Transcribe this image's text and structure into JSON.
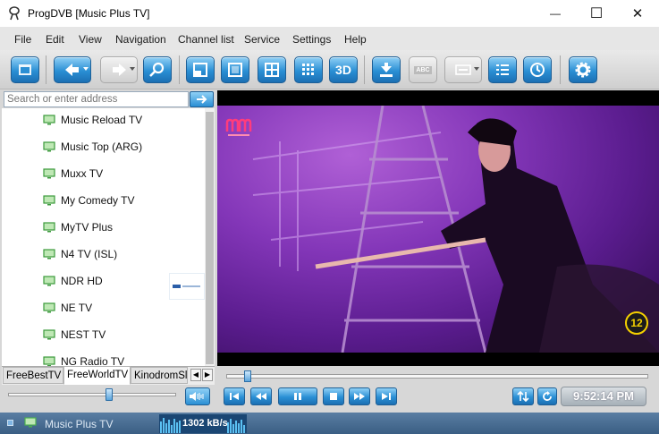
{
  "window": {
    "title": "ProgDVB [Music Plus TV]",
    "minimize_glyph": "—",
    "maximize_glyph": "☐",
    "close_glyph": "✕"
  },
  "menu": [
    "File",
    "Edit",
    "View",
    "Navigation",
    "Channel list",
    "Service",
    "Settings",
    "Help"
  ],
  "toolbar": {
    "buttons": [
      "folder-icon",
      "back-icon",
      "forward-icon",
      "search-icon",
      "window-icon",
      "fullscreen-icon",
      "grid-icon",
      "mosaic-icon",
      "3d-icon",
      "record-icon",
      "teletext-icon",
      "subtitles-icon",
      "channel-list-icon",
      "scheduler-icon",
      "settings-icon"
    ],
    "three_d_label": "3D",
    "teletext_label": "ABC"
  },
  "address": {
    "placeholder": "Search or enter address"
  },
  "channels": [
    "Music Reload TV",
    "Music Top (ARG)",
    "Muxx TV",
    "My Comedy TV",
    "MyTV Plus",
    "N4 TV (ISL)",
    "NDR HD",
    "NE TV",
    "NEST TV",
    "NG Radio TV"
  ],
  "tabs": {
    "items": [
      "FreeBestTV",
      "FreeWorldTV",
      "KinodromSly"
    ],
    "active": "FreeWorldTV",
    "scroll_left": "◀",
    "scroll_right": "▶"
  },
  "video": {
    "age_rating": "12"
  },
  "player": {
    "clock": "9:52:14 PM",
    "volume_level": 0.6,
    "seek_position": 0.05
  },
  "status": {
    "channel": "Music Plus TV",
    "bitrate": "1302 kB/s"
  },
  "colors": {
    "accent": "#2a8fd4",
    "status_bg": "#4a6e93",
    "channel_icon": "#4caf50"
  }
}
